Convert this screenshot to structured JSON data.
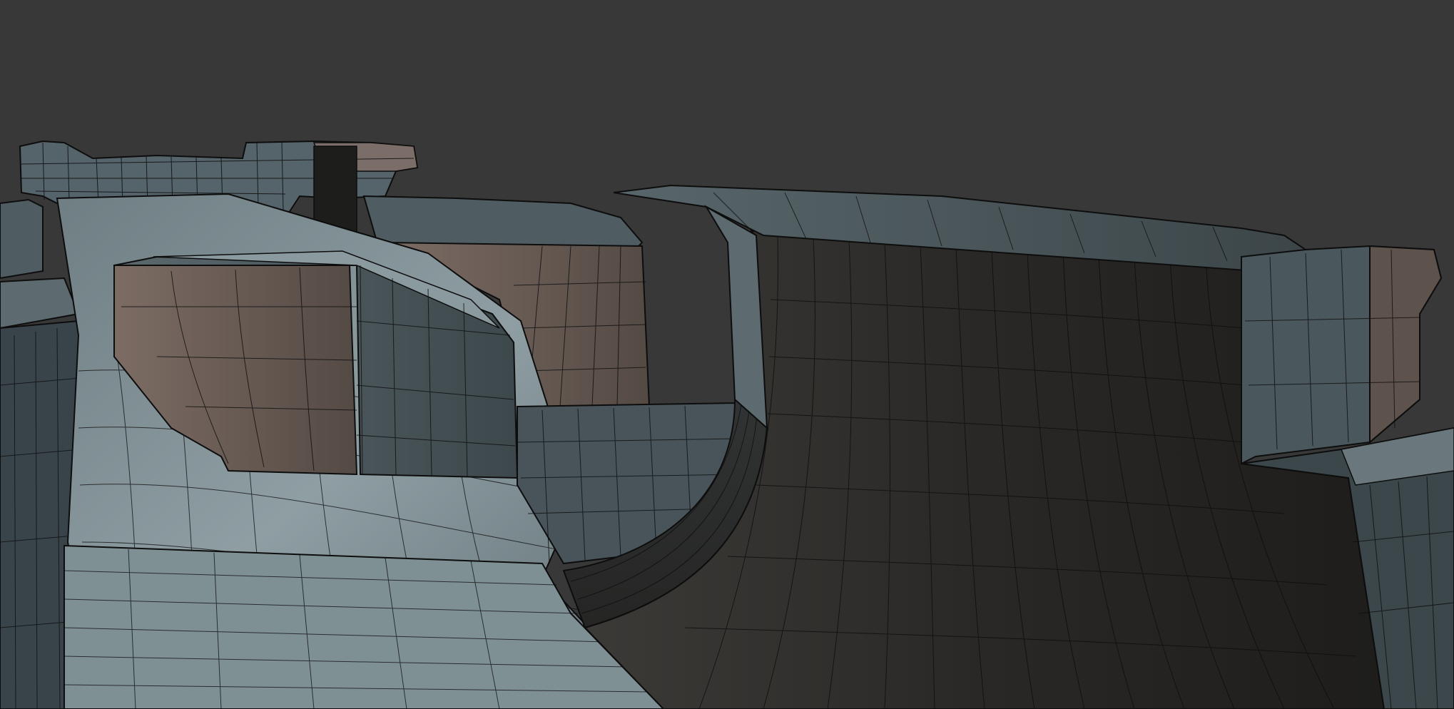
{
  "viewport": {
    "background_color": "#383838",
    "render_style": "wireframe-on-shaded",
    "wire_color": "#0d0d0d"
  },
  "materials": {
    "top_face_light": "#8e9ea3",
    "top_face_mid": "#6f7e83",
    "side_face_blue": "#4a575c",
    "side_face_dark": "#2a2826",
    "side_face_warm": "#5e524c",
    "inner_face_warm": "#6a5e56",
    "highlight_pink": "#a08a86"
  }
}
